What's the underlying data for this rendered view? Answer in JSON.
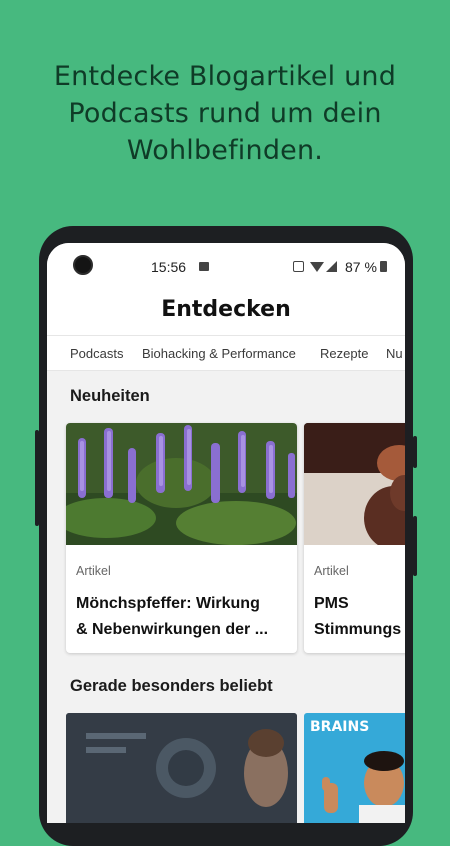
{
  "promo": {
    "lines": [
      "Entdecke Blogartikel und",
      "Podcasts rund um dein",
      "Wohlbefinden."
    ]
  },
  "status_bar": {
    "time": "15:56",
    "battery": "87 %"
  },
  "app": {
    "title": "Entdecken"
  },
  "tabs": [
    "Podcasts",
    "Biohacking & Performance",
    "Rezepte",
    "Nu"
  ],
  "sections": [
    {
      "title": "Neuheiten",
      "cards": [
        {
          "type": "Artikel",
          "title_lines": [
            "Mönchspfeffer: Wirkung",
            "& Nebenwirkungen der ..."
          ]
        },
        {
          "type": "Artikel",
          "title_lines": [
            "PMS",
            "Stimmungs"
          ]
        }
      ]
    },
    {
      "title": "Gerade besonders beliebt",
      "thumb_text": "BRAINS"
    }
  ],
  "colors": {
    "background": "#47b97f",
    "headline": "#0f3b27",
    "phone": "#1d1f22"
  }
}
